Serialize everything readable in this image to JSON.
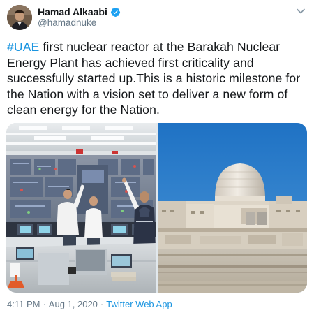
{
  "author": {
    "name": "Hamad Alkaabi",
    "handle": "@hamadnuke",
    "verified_icon": "verified-badge-icon"
  },
  "tweet": {
    "hashtag": "#UAE",
    "text": " first nuclear reactor at the Barakah Nuclear Energy Plant has achieved first criticality and successfully started up.This is a historic milestone for the Nation with a vision set to deliver a new form of clean energy for the Nation."
  },
  "meta": {
    "time": "4:11 PM",
    "separator1": "·",
    "date": "Aug 1, 2020",
    "separator2": "·",
    "source": "Twitter Web App"
  },
  "colors": {
    "link": "#1b95e0",
    "secondary_text": "#657786",
    "verified": "#1da1f2"
  }
}
